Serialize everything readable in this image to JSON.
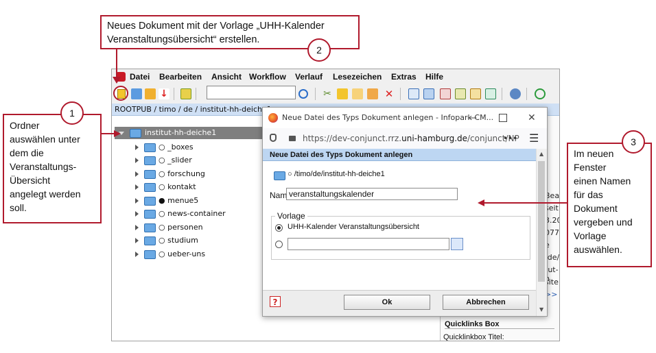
{
  "app": {
    "menu": [
      "Datei",
      "Bearbeiten",
      "Ansicht",
      "Workflow",
      "Verlauf",
      "Lesezeichen",
      "Extras",
      "Hilfe"
    ],
    "breadcrumb": "ROOTPUB / timo / de / institut-hh-deiche1",
    "tree": {
      "root": "institut-hh-deiche1",
      "items": [
        "_boxes",
        "_slider",
        "forschung",
        "kontakt",
        "menue5",
        "news-container",
        "personen",
        "studium",
        "ueber-uns"
      ]
    },
    "right_pane": {
      "fragments": [
        "Bea",
        "seit",
        "3.20",
        "077",
        "e",
        "/de/",
        "tut-h",
        "site",
        ">>"
      ],
      "quicklinks_title": "Quicklinks Box",
      "quicklinks_label": "Quicklinkbox Titel:"
    }
  },
  "dialog": {
    "window_title": "Neue Datei des Typs Dokument anlegen - Infopark CM...",
    "url_prefix": "https://dev-conjunct.rrz.",
    "url_domain": "uni-hamburg.de",
    "url_suffix": "/conjunct/NP",
    "url_more": "•••",
    "header": "Neue Datei des Typs Dokument anlegen",
    "path": "/timo/de/institut-hh-deiche1",
    "name_label": "Name:",
    "name_value": "veranstaltungskalender",
    "vorlage_legend": "Vorlage",
    "option1": "UHH-Kalender Veranstaltungsübersicht",
    "ok": "Ok",
    "cancel": "Abbrechen",
    "help": "?"
  },
  "callouts": {
    "c1": {
      "number": "1",
      "lines": [
        "Ordner",
        "auswählen unter",
        "dem die",
        "Veranstaltungs-",
        "Übersicht",
        "angelegt werden",
        "soll."
      ]
    },
    "c2": {
      "number": "2",
      "lines": [
        "Neues Dokument mit der Vorlage „UHH-Kalender",
        "Veranstaltungsübersicht“ erstellen."
      ]
    },
    "c3": {
      "number": "3",
      "lines": [
        "Im neuen",
        "Fenster",
        "einen Namen",
        "für das",
        "Dokument",
        "vergeben und",
        "Vorlage",
        "auswählen."
      ]
    }
  },
  "colors": {
    "callout_border": "#b0192c",
    "tree_selected": "#7f7f7f",
    "breadcrumb_bg": "#cfe0f5",
    "dialog_header_bg": "#bdd6f2"
  }
}
